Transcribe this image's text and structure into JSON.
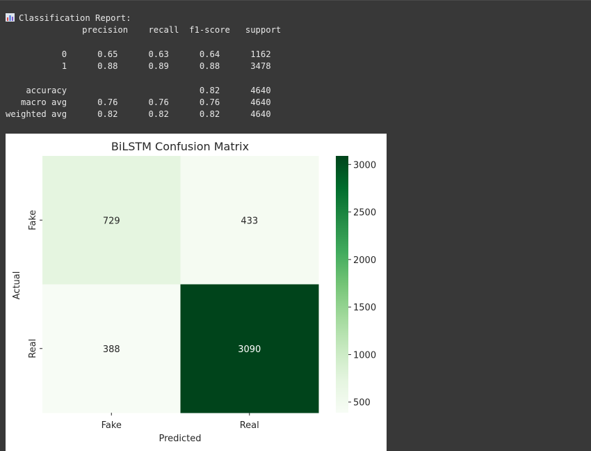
{
  "report": {
    "title": "Classification Report:",
    "icon": "bar-chart-icon",
    "header": [
      "precision",
      "recall",
      "f1-score",
      "support"
    ],
    "rows": [
      {
        "label": "0",
        "precision": "0.65",
        "recall": "0.63",
        "f1": "0.64",
        "support": "1162"
      },
      {
        "label": "1",
        "precision": "0.88",
        "recall": "0.89",
        "f1": "0.88",
        "support": "3478"
      }
    ],
    "summary": [
      {
        "label": "accuracy",
        "precision": "",
        "recall": "",
        "f1": "0.82",
        "support": "4640"
      },
      {
        "label": "macro avg",
        "precision": "0.76",
        "recall": "0.76",
        "f1": "0.76",
        "support": "4640"
      },
      {
        "label": "weighted avg",
        "precision": "0.82",
        "recall": "0.82",
        "f1": "0.82",
        "support": "4640"
      }
    ]
  },
  "chart_data": {
    "type": "heatmap",
    "title": "BiLSTM Confusion Matrix",
    "xlabel": "Predicted",
    "ylabel": "Actual",
    "x_categories": [
      "Fake",
      "Real"
    ],
    "y_categories": [
      "Fake",
      "Real"
    ],
    "values": [
      [
        729,
        433
      ],
      [
        388,
        3090
      ]
    ],
    "colormap": "Greens",
    "colorbar": {
      "ticks": [
        500,
        1000,
        1500,
        2000,
        2500,
        3000
      ],
      "range": [
        388,
        3090
      ]
    },
    "colors": {
      "low": "#f7fcf5",
      "high": "#00441b"
    }
  }
}
